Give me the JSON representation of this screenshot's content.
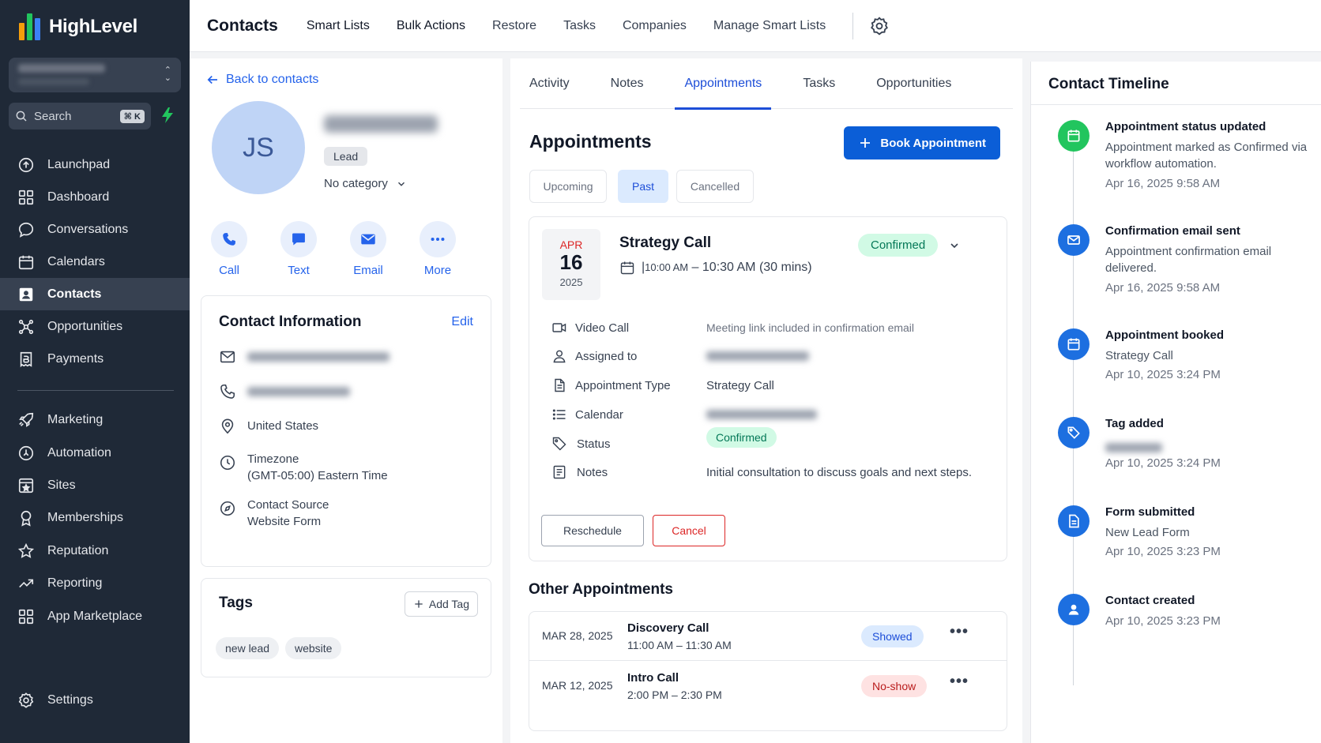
{
  "app": {
    "brand": "HighLevel"
  },
  "sidebar": {
    "search_placeholder": "Search",
    "shortcut": "⌘ K",
    "items": [
      {
        "label": "Launchpad",
        "icon": "rocket-circle-icon"
      },
      {
        "label": "Dashboard",
        "icon": "grid-icon"
      },
      {
        "label": "Conversations",
        "icon": "chat-icon"
      },
      {
        "label": "Calendars",
        "icon": "calendar-icon"
      },
      {
        "label": "Contacts",
        "icon": "contact-card-icon",
        "active": true
      },
      {
        "label": "Opportunities",
        "icon": "network-icon"
      },
      {
        "label": "Payments",
        "icon": "receipt-icon"
      }
    ],
    "items2": [
      {
        "label": "Marketing",
        "icon": "rocket-icon"
      },
      {
        "label": "Automation",
        "icon": "automation-icon"
      },
      {
        "label": "Sites",
        "icon": "sites-icon"
      },
      {
        "label": "Memberships",
        "icon": "badge-icon"
      },
      {
        "label": "Reputation",
        "icon": "star-icon"
      },
      {
        "label": "Reporting",
        "icon": "trend-icon"
      },
      {
        "label": "App Marketplace",
        "icon": "apps-grid-icon"
      }
    ],
    "settings": "Settings"
  },
  "topbar": {
    "title": "Contacts",
    "links": [
      "Smart Lists",
      "Bulk Actions",
      "Restore",
      "Tasks",
      "Companies",
      "Manage Smart Lists"
    ]
  },
  "contact": {
    "back": "Back to contacts",
    "initials": "JS",
    "tag": "Lead",
    "category": "No category",
    "actions": [
      "Call",
      "Text",
      "Email",
      "More"
    ],
    "info_title": "Contact Information",
    "edit": "Edit",
    "country": "United States",
    "timezone_label": "Timezone",
    "timezone": "(GMT-05:00) Eastern Time",
    "source_label": "Contact Source",
    "source": "Website Form",
    "tags_title": "Tags",
    "add_tag": "Add Tag",
    "tags": [
      "new lead",
      "website"
    ]
  },
  "tabs": [
    "Activity",
    "Notes",
    "Appointments",
    "Tasks",
    "Opportunities"
  ],
  "appointments": {
    "heading": "Appointments",
    "book": "Book Appointment",
    "filters": [
      "Upcoming",
      "Past",
      "Cancelled"
    ],
    "current": {
      "month": "APR",
      "day": "16",
      "year": "2025",
      "name": "Strategy Call",
      "time_start": "10:00 AM",
      "time_rest": "10:30 AM (30 mins)",
      "status": "Confirmed",
      "rows": [
        {
          "label": "Video Call",
          "value": "Meeting link included in confirmation email"
        },
        {
          "label": "Assigned to",
          "value": ""
        },
        {
          "label": "Appointment Type",
          "value": "Strategy Call"
        },
        {
          "label": "Calendar",
          "value": ""
        },
        {
          "label": "Status",
          "value": "Confirmed"
        },
        {
          "label": "Notes",
          "value": "Initial consultation to discuss goals and next steps."
        }
      ],
      "reschedule": "Reschedule",
      "cancel": "Cancel"
    },
    "other_heading": "Other Appointments",
    "other": [
      {
        "date": "MAR 28, 2025",
        "name": "Discovery Call",
        "time": "11:00 AM – 11:30 AM",
        "status": "Showed"
      },
      {
        "date": "MAR 12, 2025",
        "name": "Intro Call",
        "time": "2:00 PM – 2:30 PM",
        "status": "No-show"
      }
    ]
  },
  "timeline": {
    "title": "Contact Timeline",
    "items": [
      {
        "title": "Appointment status updated",
        "desc": "Appointment marked as Confirmed via workflow automation.",
        "time": "Apr 16, 2025 9:58 AM",
        "icon": "calendar-icon",
        "color": "#22c55e"
      },
      {
        "title": "Confirmation email sent",
        "desc": "Appointment confirmation email delivered.",
        "time": "Apr 16, 2025 9:58 AM",
        "icon": "email-icon",
        "color": "#1d6fe0"
      },
      {
        "title": "Appointment booked",
        "desc": "Strategy Call",
        "time": "Apr 10, 2025 3:24 PM",
        "icon": "calendar-icon",
        "color": "#1d6fe0"
      },
      {
        "title": "Tag added",
        "desc": "",
        "time": "Apr 10, 2025 3:24 PM",
        "icon": "tag-icon",
        "color": "#1d6fe0"
      },
      {
        "title": "Form submitted",
        "desc": "New Lead Form",
        "time": "Apr 10, 2025 3:23 PM",
        "icon": "document-icon",
        "color": "#1d6fe0"
      },
      {
        "title": "Contact created",
        "desc": "",
        "time": "Apr 10, 2025 3:23 PM",
        "icon": "user-icon",
        "color": "#1d6fe0"
      }
    ]
  },
  "colors": {
    "sidebar": "#1f2937",
    "primary": "#0b5ed7",
    "accent_blue": "#2563eb",
    "confirmed_bg": "#d1fae5",
    "danger": "#dc2626"
  }
}
